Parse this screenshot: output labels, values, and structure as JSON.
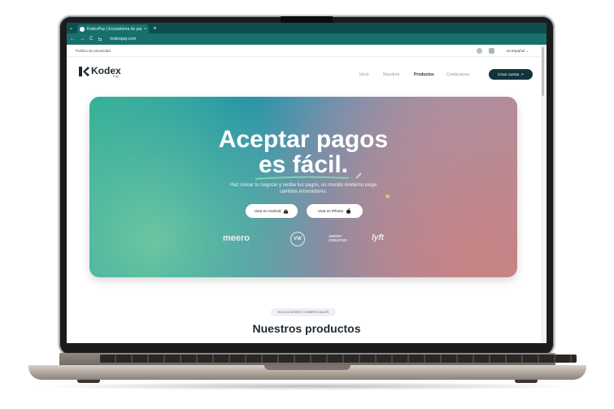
{
  "browser": {
    "tab_title": "KodexPay | Ecosistema de pag...",
    "tab_close": "×",
    "new_tab": "+",
    "url": "kodexpay.com",
    "nav_back": "←",
    "nav_forward": "→",
    "nav_reload": "C"
  },
  "topbar": {
    "policy_link": "Política de privacidad",
    "language": "es Español"
  },
  "header": {
    "brand": "Kodex",
    "brand_sub": "Pay",
    "menu": [
      "Inicio",
      "Nosotros",
      "Productos",
      "Contáctanos"
    ],
    "cta": "Crear cuenta",
    "cta_arrow": "↗"
  },
  "hero": {
    "title_line1": "Aceptar pagos",
    "title_line2": "es fácil.",
    "lead": "Haz crecer tu negocio y recibe tus pagos, un mundo moderno exige cambios innovadores.",
    "btn_android": "Usar en Android",
    "btn_iphone": "Usar en iPhone",
    "partners": [
      "meero",
      "VW",
      "ANGRY CREATIVE",
      "lyft"
    ]
  },
  "section": {
    "chip": "SOLUCIONES COMERCIALES",
    "title": "Nuestros productos"
  },
  "colors": {
    "browser_dark": "#0f4e4e",
    "browser_bar": "#17706e",
    "cta_bg": "#13343a",
    "accent_underline": "#7fd4b0"
  }
}
